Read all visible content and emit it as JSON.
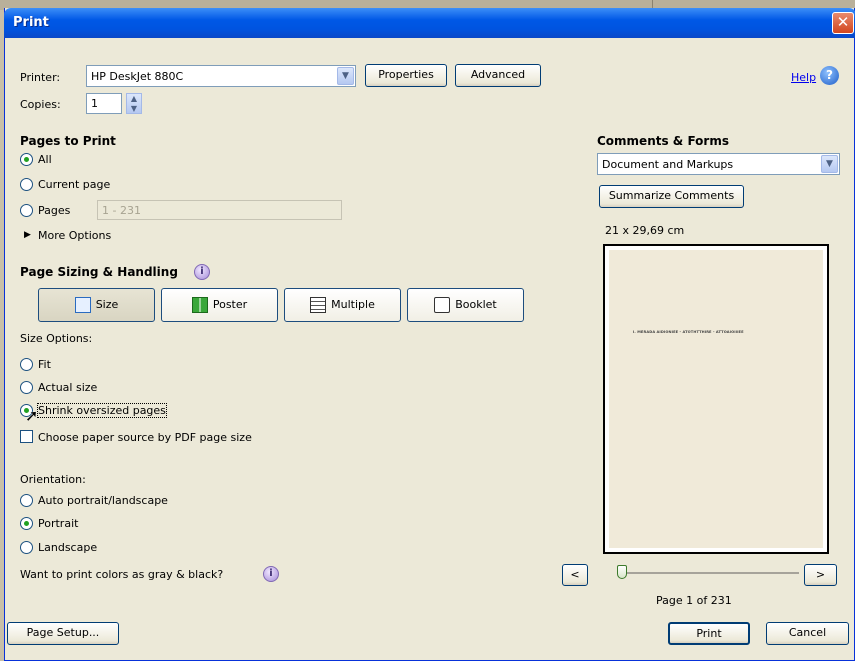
{
  "window": {
    "title": "Print"
  },
  "printer": {
    "label": "Printer:",
    "selected": "HP DeskJet 880C",
    "properties_label": "Properties",
    "advanced_label": "Advanced",
    "help_label": "Help"
  },
  "copies": {
    "label": "Copies:",
    "value": "1"
  },
  "pages_to_print": {
    "heading": "Pages to Print",
    "all_label": "All",
    "current_label": "Current page",
    "pages_label": "Pages",
    "pages_value": "1 - 231",
    "more_options": "More Options",
    "selected": "All"
  },
  "page_sizing": {
    "heading": "Page Sizing & Handling",
    "buttons": [
      "Size",
      "Poster",
      "Multiple",
      "Booklet"
    ],
    "active": "Size",
    "size_options_label": "Size Options:",
    "options": [
      "Fit",
      "Actual size",
      "Shrink oversized pages"
    ],
    "selected_option": "Shrink oversized pages",
    "paper_source_label": "Choose paper source by PDF page size",
    "paper_source_checked": false
  },
  "orientation": {
    "label": "Orientation:",
    "options": [
      "Auto portrait/landscape",
      "Portrait",
      "Landscape"
    ],
    "selected": "Portrait"
  },
  "grayscale": {
    "label": "Want to print colors as gray & black?"
  },
  "comments": {
    "heading": "Comments & Forms",
    "selected": "Document and Markups",
    "summarize_label": "Summarize Comments"
  },
  "preview": {
    "paper_size": "21 x 29,69 cm",
    "page_text": "I. MERADA AIDIONIEE - ATOTHTTHIRE - ATTOAIOIIIEE",
    "prev_label": "<",
    "next_label": ">",
    "page_status": "Page 1 of 231",
    "current_page": 1,
    "total_pages": 231
  },
  "footer": {
    "page_setup_label": "Page Setup...",
    "print_label": "Print",
    "cancel_label": "Cancel"
  },
  "colors": {
    "title_bar": "#0054e0",
    "dialog_bg": "#ece9d8",
    "accent_link": "#0000ee"
  }
}
